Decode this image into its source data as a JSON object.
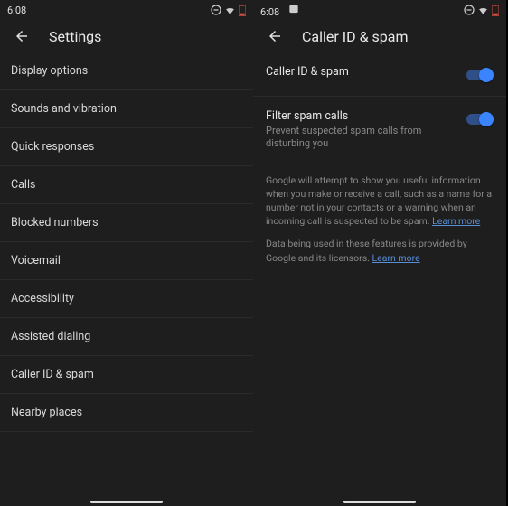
{
  "left": {
    "status_time": "6:08",
    "header_title": "Settings",
    "items": [
      {
        "label": "Display options"
      },
      {
        "label": "Sounds and vibration"
      },
      {
        "label": "Quick responses"
      },
      {
        "label": "Calls"
      },
      {
        "label": "Blocked numbers"
      },
      {
        "label": "Voicemail"
      },
      {
        "label": "Accessibility"
      },
      {
        "label": "Assisted dialing"
      },
      {
        "label": "Caller ID & spam"
      },
      {
        "label": "Nearby places"
      }
    ]
  },
  "right": {
    "status_time": "6:08",
    "header_title": "Caller ID & spam",
    "toggle_callerid": {
      "title": "Caller ID & spam",
      "on": true
    },
    "toggle_filter": {
      "title": "Filter spam calls",
      "sub": "Prevent suspected spam calls from disturbing you",
      "on": true
    },
    "info1": "Google will attempt to show you useful information when you make or receive a call, such as a name for a number not in your contacts or a warning when an incoming call is suspected to be spam. ",
    "info2": "Data being used in these features is provided by Google and its licensors. ",
    "learn_more": "Learn more"
  }
}
